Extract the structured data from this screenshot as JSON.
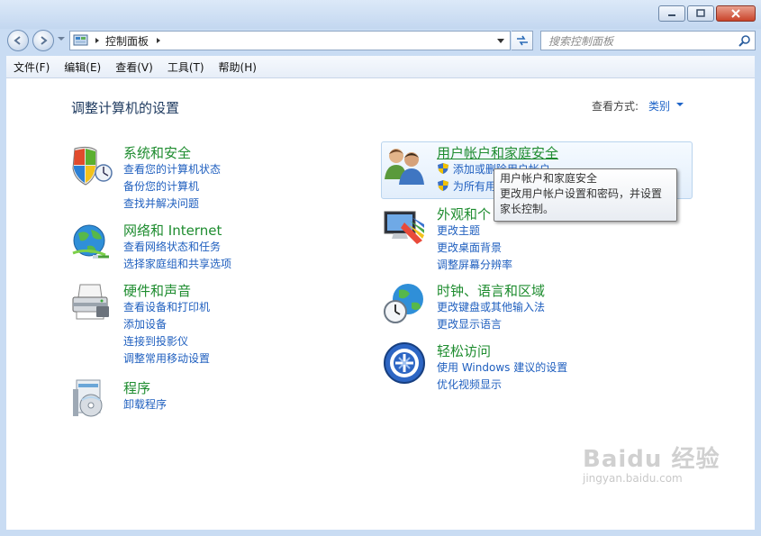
{
  "window": {
    "minimize_label": "–",
    "maximize_label": "□",
    "close_label": "✕"
  },
  "nav": {
    "back_icon": "back-arrow-icon",
    "forward_icon": "forward-arrow-icon"
  },
  "address_bar": {
    "breadcrumb": "控制面板",
    "refresh_icon": "refresh-icon"
  },
  "search": {
    "placeholder": "搜索控制面板"
  },
  "menu": [
    {
      "label": "文件(F)"
    },
    {
      "label": "编辑(E)"
    },
    {
      "label": "查看(V)"
    },
    {
      "label": "工具(T)"
    },
    {
      "label": "帮助(H)"
    }
  ],
  "main": {
    "heading": "调整计算机的设置",
    "view_by_label": "查看方式:",
    "view_by_value": "类别"
  },
  "categories": [
    {
      "title": "系统和安全",
      "icon": "shield-icon",
      "links": [
        "查看您的计算机状态",
        "备份您的计算机",
        "查找并解决问题"
      ]
    },
    {
      "title": "网络和 Internet",
      "icon": "network-globe-icon",
      "links": [
        "查看网络状态和任务",
        "选择家庭组和共享选项"
      ]
    },
    {
      "title": "硬件和声音",
      "icon": "printer-icon",
      "links": [
        "查看设备和打印机",
        "添加设备",
        "连接到投影仪",
        "调整常用移动设置"
      ]
    },
    {
      "title": "程序",
      "icon": "programs-icon",
      "links": [
        "卸载程序"
      ]
    },
    {
      "title": "用户帐户和家庭安全",
      "icon": "users-icon",
      "links": [
        "添加或删除用户帐户",
        "为所有用"
      ]
    },
    {
      "title": "外观和个",
      "icon": "monitor-palette-icon",
      "links": [
        "更改主题",
        "更改桌面背景",
        "调整屏幕分辨率"
      ]
    },
    {
      "title": "时钟、语言和区域",
      "icon": "clock-globe-icon",
      "links": [
        "更改键盘或其他输入法",
        "更改显示语言"
      ]
    },
    {
      "title": "轻松访问",
      "icon": "ease-of-access-icon",
      "links": [
        "使用 Windows 建议的设置",
        "优化视频显示"
      ]
    }
  ],
  "tooltip": {
    "title": "用户帐户和家庭安全",
    "body": "更改用户帐户设置和密码，并设置家长控制。"
  },
  "watermark": {
    "logo": "Baidu 经验",
    "url": "jingyan.baidu.com"
  }
}
